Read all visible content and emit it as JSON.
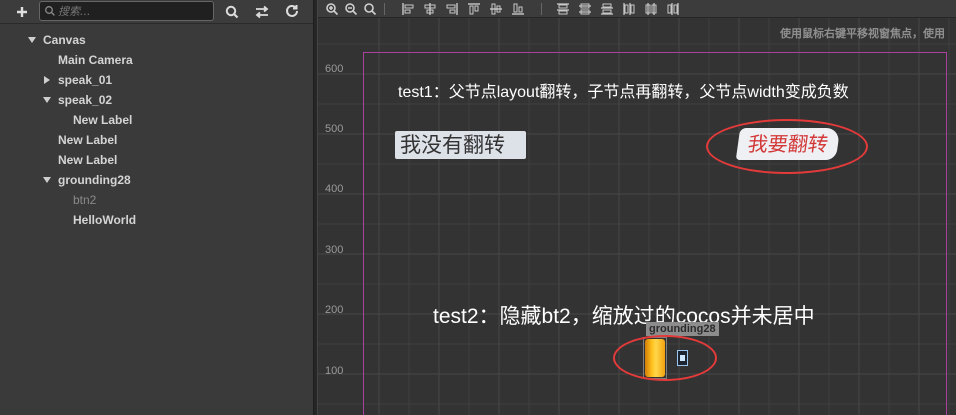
{
  "hierarchy": {
    "search_placeholder": "搜索...",
    "add_icon": "plus-icon",
    "search_icon": "search-icon",
    "swap_icon": "swap-icon",
    "refresh_icon": "refresh-icon",
    "nodes": [
      {
        "label": "Canvas",
        "arrow": "down",
        "state": "expanded"
      },
      {
        "label": "Main Camera"
      },
      {
        "label": "speak_01",
        "arrow": "right",
        "state": "collapsed"
      },
      {
        "label": "speak_02",
        "arrow": "down",
        "state": "expanded"
      },
      {
        "label": "New Label"
      },
      {
        "label": "New Label"
      },
      {
        "label": "New Label"
      },
      {
        "label": "grounding28",
        "arrow": "down",
        "state": "expanded"
      },
      {
        "label": "btn2",
        "state": "inactive"
      },
      {
        "label": "HelloWorld"
      }
    ]
  },
  "scene": {
    "hint": "使用鼠标右键平移视窗焦点，使用",
    "ruler_ticks": [
      "600",
      "500",
      "400",
      "300",
      "200",
      "100"
    ],
    "test1_text": "test1：父节点layout翻转，子节点再翻转，父节点width变成负数",
    "label_not_flipped": "我没有翻转",
    "label_flipped": "我要翻转",
    "test2_text": "test2：隐藏bt2，缩放过的cocos并未居中",
    "selected_node_tag": "grounding28",
    "colors": {
      "frame": "#a8419c",
      "highlight_ring": "#e53a3a",
      "flipped_text": "#d33838"
    }
  }
}
